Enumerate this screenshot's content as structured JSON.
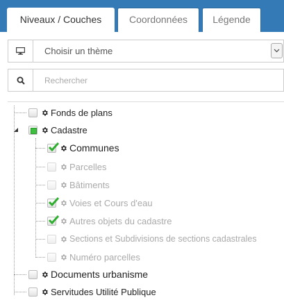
{
  "tabs": [
    {
      "label": "Niveaux / Couches",
      "active": true
    },
    {
      "label": "Coordonnées",
      "active": false
    },
    {
      "label": "Légende",
      "active": false
    }
  ],
  "theme_select": {
    "icon": "monitor-icon",
    "selected": "Choisir un thème"
  },
  "search": {
    "icon": "search-icon",
    "placeholder": "Rechercher"
  },
  "tree": {
    "fonds": {
      "label": "Fonds de plans",
      "checked": false,
      "expanded": false
    },
    "cadastre": {
      "label": "Cadastre",
      "state": "partial",
      "expanded": true,
      "children": [
        {
          "label": "Communes",
          "checked": true,
          "enabled": true
        },
        {
          "label": "Parcelles",
          "checked": false,
          "enabled": false
        },
        {
          "label": "Bâtiments",
          "checked": false,
          "enabled": false
        },
        {
          "label": "Voies et Cours d'eau",
          "checked": true,
          "enabled": false
        },
        {
          "label": "Autres objets du cadastre",
          "checked": true,
          "enabled": false
        },
        {
          "label": "Sections et Subdivisions de sections cadastrales",
          "checked": false,
          "enabled": false
        },
        {
          "label": "Numéro parcelles",
          "checked": false,
          "enabled": false
        }
      ]
    },
    "documents": {
      "label": "Documents urbanisme",
      "checked": false,
      "expanded": false
    },
    "servitudes": {
      "label": "Servitudes Utilité Publique",
      "checked": false,
      "expanded": false
    }
  },
  "colors": {
    "tabbar": "#337ab7",
    "check": "#3fbf3f",
    "disabled_text": "#aaaaaa"
  }
}
